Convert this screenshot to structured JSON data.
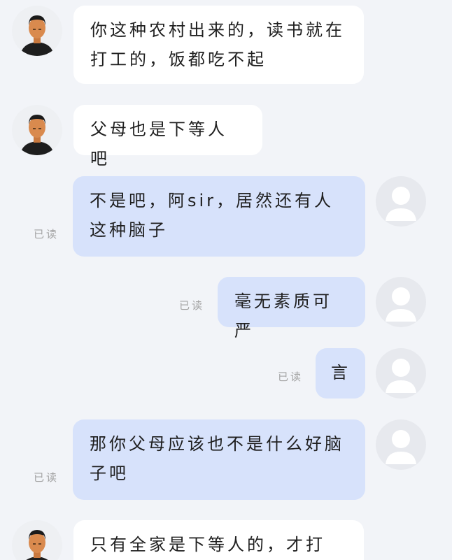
{
  "chat": {
    "read_label": "已读",
    "messages": [
      {
        "side": "left",
        "sender": "other",
        "text": "你这种农村出来的，读书就在打工的，饭都吃不起"
      },
      {
        "side": "left",
        "sender": "other",
        "text": "父母也是下等人吧"
      },
      {
        "side": "right",
        "sender": "me",
        "read": true,
        "text": "不是吧，阿sir，居然还有人这种脑子"
      },
      {
        "side": "right",
        "sender": "me",
        "read": true,
        "text": "毫无素质可严"
      },
      {
        "side": "right",
        "sender": "me",
        "read": true,
        "text": "言"
      },
      {
        "side": "right",
        "sender": "me",
        "read": true,
        "text": "那你父母应该也不是什么好脑子吧"
      },
      {
        "side": "left",
        "sender": "other",
        "text": "只有全家是下等人的，才打"
      }
    ]
  },
  "colors": {
    "background": "#f2f4f8",
    "incoming_bubble": "#ffffff",
    "outgoing_bubble": "#d7e2fb",
    "read_receipt": "#a3a3a3"
  },
  "icons": {
    "other_avatar": "cartoon-man-avatar-icon",
    "my_avatar": "default-user-avatar-icon"
  }
}
